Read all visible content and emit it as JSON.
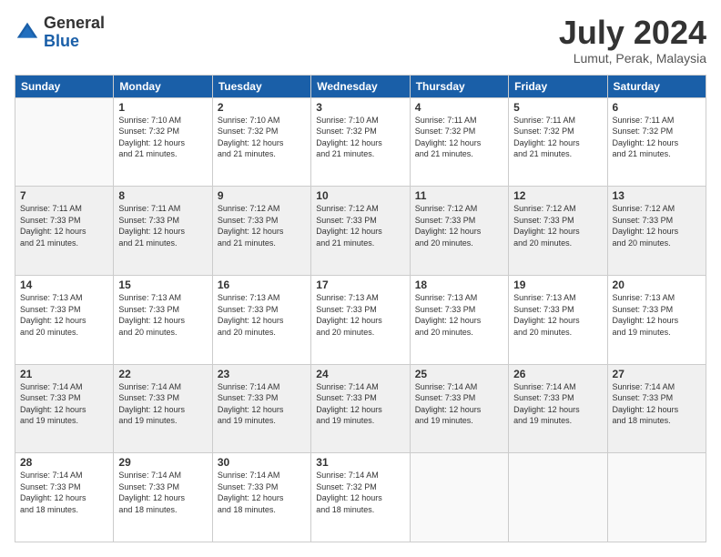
{
  "logo": {
    "general": "General",
    "blue": "Blue"
  },
  "header": {
    "month_year": "July 2024",
    "location": "Lumut, Perak, Malaysia"
  },
  "days_of_week": [
    "Sunday",
    "Monday",
    "Tuesday",
    "Wednesday",
    "Thursday",
    "Friday",
    "Saturday"
  ],
  "weeks": [
    {
      "shaded": false,
      "days": [
        {
          "num": "",
          "info": ""
        },
        {
          "num": "1",
          "info": "Sunrise: 7:10 AM\nSunset: 7:32 PM\nDaylight: 12 hours\nand 21 minutes."
        },
        {
          "num": "2",
          "info": "Sunrise: 7:10 AM\nSunset: 7:32 PM\nDaylight: 12 hours\nand 21 minutes."
        },
        {
          "num": "3",
          "info": "Sunrise: 7:10 AM\nSunset: 7:32 PM\nDaylight: 12 hours\nand 21 minutes."
        },
        {
          "num": "4",
          "info": "Sunrise: 7:11 AM\nSunset: 7:32 PM\nDaylight: 12 hours\nand 21 minutes."
        },
        {
          "num": "5",
          "info": "Sunrise: 7:11 AM\nSunset: 7:32 PM\nDaylight: 12 hours\nand 21 minutes."
        },
        {
          "num": "6",
          "info": "Sunrise: 7:11 AM\nSunset: 7:32 PM\nDaylight: 12 hours\nand 21 minutes."
        }
      ]
    },
    {
      "shaded": true,
      "days": [
        {
          "num": "7",
          "info": "Sunrise: 7:11 AM\nSunset: 7:33 PM\nDaylight: 12 hours\nand 21 minutes."
        },
        {
          "num": "8",
          "info": "Sunrise: 7:11 AM\nSunset: 7:33 PM\nDaylight: 12 hours\nand 21 minutes."
        },
        {
          "num": "9",
          "info": "Sunrise: 7:12 AM\nSunset: 7:33 PM\nDaylight: 12 hours\nand 21 minutes."
        },
        {
          "num": "10",
          "info": "Sunrise: 7:12 AM\nSunset: 7:33 PM\nDaylight: 12 hours\nand 21 minutes."
        },
        {
          "num": "11",
          "info": "Sunrise: 7:12 AM\nSunset: 7:33 PM\nDaylight: 12 hours\nand 20 minutes."
        },
        {
          "num": "12",
          "info": "Sunrise: 7:12 AM\nSunset: 7:33 PM\nDaylight: 12 hours\nand 20 minutes."
        },
        {
          "num": "13",
          "info": "Sunrise: 7:12 AM\nSunset: 7:33 PM\nDaylight: 12 hours\nand 20 minutes."
        }
      ]
    },
    {
      "shaded": false,
      "days": [
        {
          "num": "14",
          "info": "Sunrise: 7:13 AM\nSunset: 7:33 PM\nDaylight: 12 hours\nand 20 minutes."
        },
        {
          "num": "15",
          "info": "Sunrise: 7:13 AM\nSunset: 7:33 PM\nDaylight: 12 hours\nand 20 minutes."
        },
        {
          "num": "16",
          "info": "Sunrise: 7:13 AM\nSunset: 7:33 PM\nDaylight: 12 hours\nand 20 minutes."
        },
        {
          "num": "17",
          "info": "Sunrise: 7:13 AM\nSunset: 7:33 PM\nDaylight: 12 hours\nand 20 minutes."
        },
        {
          "num": "18",
          "info": "Sunrise: 7:13 AM\nSunset: 7:33 PM\nDaylight: 12 hours\nand 20 minutes."
        },
        {
          "num": "19",
          "info": "Sunrise: 7:13 AM\nSunset: 7:33 PM\nDaylight: 12 hours\nand 20 minutes."
        },
        {
          "num": "20",
          "info": "Sunrise: 7:13 AM\nSunset: 7:33 PM\nDaylight: 12 hours\nand 19 minutes."
        }
      ]
    },
    {
      "shaded": true,
      "days": [
        {
          "num": "21",
          "info": "Sunrise: 7:14 AM\nSunset: 7:33 PM\nDaylight: 12 hours\nand 19 minutes."
        },
        {
          "num": "22",
          "info": "Sunrise: 7:14 AM\nSunset: 7:33 PM\nDaylight: 12 hours\nand 19 minutes."
        },
        {
          "num": "23",
          "info": "Sunrise: 7:14 AM\nSunset: 7:33 PM\nDaylight: 12 hours\nand 19 minutes."
        },
        {
          "num": "24",
          "info": "Sunrise: 7:14 AM\nSunset: 7:33 PM\nDaylight: 12 hours\nand 19 minutes."
        },
        {
          "num": "25",
          "info": "Sunrise: 7:14 AM\nSunset: 7:33 PM\nDaylight: 12 hours\nand 19 minutes."
        },
        {
          "num": "26",
          "info": "Sunrise: 7:14 AM\nSunset: 7:33 PM\nDaylight: 12 hours\nand 19 minutes."
        },
        {
          "num": "27",
          "info": "Sunrise: 7:14 AM\nSunset: 7:33 PM\nDaylight: 12 hours\nand 18 minutes."
        }
      ]
    },
    {
      "shaded": false,
      "days": [
        {
          "num": "28",
          "info": "Sunrise: 7:14 AM\nSunset: 7:33 PM\nDaylight: 12 hours\nand 18 minutes."
        },
        {
          "num": "29",
          "info": "Sunrise: 7:14 AM\nSunset: 7:33 PM\nDaylight: 12 hours\nand 18 minutes."
        },
        {
          "num": "30",
          "info": "Sunrise: 7:14 AM\nSunset: 7:33 PM\nDaylight: 12 hours\nand 18 minutes."
        },
        {
          "num": "31",
          "info": "Sunrise: 7:14 AM\nSunset: 7:32 PM\nDaylight: 12 hours\nand 18 minutes."
        },
        {
          "num": "",
          "info": ""
        },
        {
          "num": "",
          "info": ""
        },
        {
          "num": "",
          "info": ""
        }
      ]
    }
  ]
}
